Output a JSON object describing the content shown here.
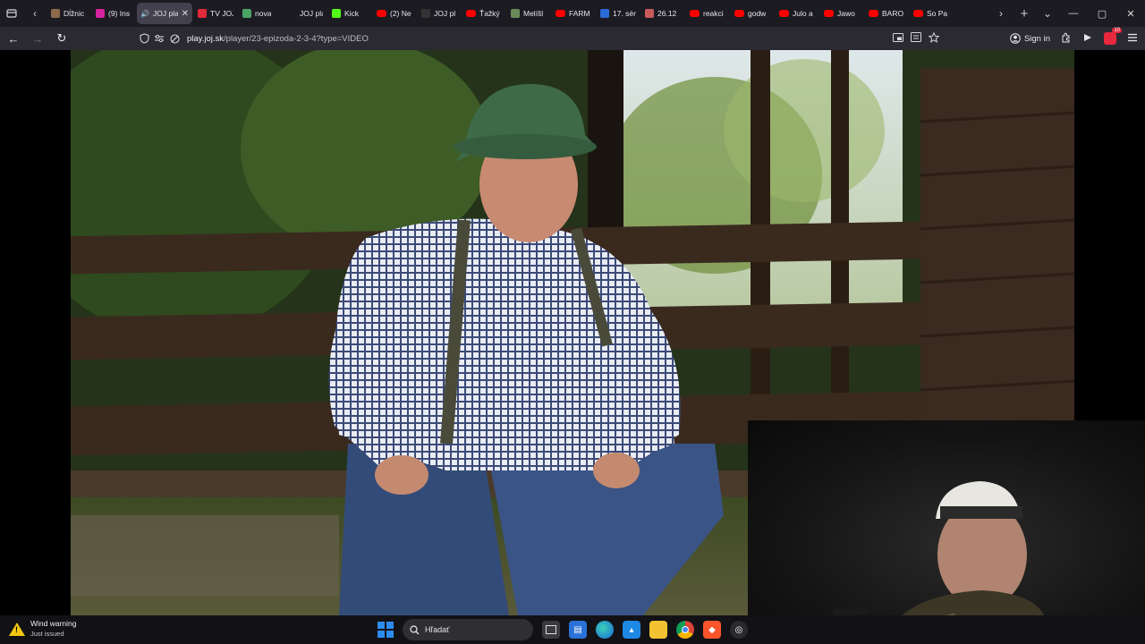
{
  "browser": {
    "tabs": [
      {
        "label": "Dĺžnic",
        "icon": "page-icon",
        "color": "#8a6a4a"
      },
      {
        "label": "(9) Ins",
        "icon": "instagram-icon",
        "color": "#d6249f"
      },
      {
        "label": "JOJ pla",
        "icon": "speaker-icon",
        "active": true,
        "close": "✕"
      },
      {
        "label": "TV JOJ",
        "icon": "power-icon",
        "color": "#e0293a"
      },
      {
        "label": "nova",
        "icon": "chrome-icon",
        "color": "#4aa564"
      },
      {
        "label": "JOJ play",
        "icon": "joj-icon",
        "color": "#1c1b22"
      },
      {
        "label": "Kick",
        "icon": "kick-icon",
        "color": "#53fc18"
      },
      {
        "label": "(2) Ne",
        "icon": "youtube-icon"
      },
      {
        "label": "JOJ pl",
        "icon": "joj-icon",
        "color": "#333"
      },
      {
        "label": "Ťažký",
        "icon": "youtube-icon"
      },
      {
        "label": "Melíšl",
        "icon": "page-icon",
        "color": "#6a8a5a"
      },
      {
        "label": "FARM",
        "icon": "youtube-icon"
      },
      {
        "label": "17. sér",
        "icon": "v-icon",
        "color": "#2a6bd6"
      },
      {
        "label": "26.12",
        "icon": "page-icon",
        "color": "#c85a5a"
      },
      {
        "label": "reakci",
        "icon": "youtube-icon"
      },
      {
        "label": "godw",
        "icon": "youtube-icon"
      },
      {
        "label": "Julo a",
        "icon": "youtube-icon"
      },
      {
        "label": "Jawo",
        "icon": "youtube-icon"
      },
      {
        "label": "BARO",
        "icon": "youtube-icon"
      },
      {
        "label": "So Pa",
        "icon": "youtube-icon"
      }
    ],
    "tab_scroll_right": "›",
    "tab_scroll_left": "‹",
    "new_tab": "+",
    "list_tabs": "⌄",
    "window": {
      "minimize": "—",
      "maximize": "▢",
      "close": "✕"
    },
    "nav": {
      "back": "←",
      "forward": "→",
      "reload": "↻"
    },
    "url": {
      "domain": "play.joj.sk",
      "path": "/player/23-epizoda-2-3-4?type=VIDEO"
    },
    "sign_in": "Sign in",
    "notification_count": "10"
  },
  "taskbar": {
    "warning_title": "Wind warning",
    "warning_sub": "Just issued",
    "search_placeholder": "Hľadať"
  },
  "colors": {
    "tabbar_bg": "#1c1b22",
    "navbar_bg": "#2b2a33",
    "active_tab": "#42414d",
    "youtube_red": "#ff0000",
    "warning_yellow": "#f2c811"
  }
}
